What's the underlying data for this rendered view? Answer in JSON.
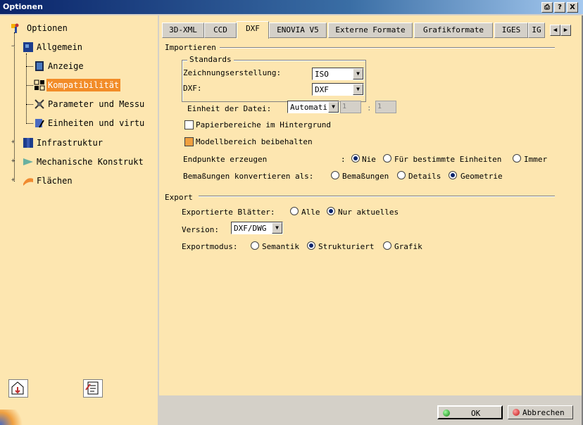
{
  "window": {
    "title": "Optionen",
    "buttons": [
      "⎙",
      "?",
      "X"
    ]
  },
  "tree": {
    "root": "Optionen",
    "items": [
      {
        "label": "Allgemein",
        "icon": "general-icon"
      },
      {
        "label": "Anzeige",
        "icon": "display-icon"
      },
      {
        "label": "Kompatibilität",
        "icon": "compatibility-icon",
        "selected": true
      },
      {
        "label": "Parameter und Messu",
        "icon": "parameter-icon"
      },
      {
        "label": "Einheiten und virtu",
        "icon": "units-icon"
      },
      {
        "label": "Infrastruktur",
        "icon": "infrastructure-icon"
      },
      {
        "label": "Mechanische Konstrukt",
        "icon": "mechanical-icon"
      },
      {
        "label": "Flächen",
        "icon": "surfaces-icon"
      }
    ]
  },
  "tabs": [
    "3D-XML",
    "CCD",
    "DXF",
    "ENOVIA V5",
    "Externe Formate",
    "Grafikformate",
    "IGES",
    "IG"
  ],
  "active_tab": "DXF",
  "import": {
    "section": "Importieren",
    "standards_label": "Standards",
    "drawing_label": "Zeichnungserstellung:",
    "drawing_value": "ISO",
    "dxf_label": "DXF:",
    "dxf_value": "DXF",
    "unit_label": "Einheit der Datei:",
    "unit_value": "Automati",
    "unit_num1": "1",
    "unit_num2": "1",
    "paper_bg_label": "Papierbereiche im Hintergrund",
    "keep_model_label": "Modellbereich beibehalten",
    "endpoints_label": "Endpunkte erzeugen",
    "endpoints_colon": ":",
    "endpoints_options": [
      "Nie",
      "Für bestimmte Einheiten",
      "Immer"
    ],
    "dims_label": "Bemaßungen konvertieren als:",
    "dims_options": [
      "Bemaßungen",
      "Details",
      "Geometrie"
    ]
  },
  "export": {
    "section": "Export",
    "sheets_label": "Exportierte Blätter:",
    "sheets_options": [
      "Alle",
      "Nur aktuelles"
    ],
    "version_label": "Version:",
    "version_value": "DXF/DWG",
    "mode_label": "Exportmodus:",
    "mode_options": [
      "Semantik",
      "Strukturiert",
      "Grafik"
    ]
  },
  "footer": {
    "ok": "OK",
    "cancel": "Abbrechen"
  },
  "colors": {
    "panel": "#fde6b0",
    "selection": "#f28c28",
    "title_bar": "#0a246a"
  }
}
